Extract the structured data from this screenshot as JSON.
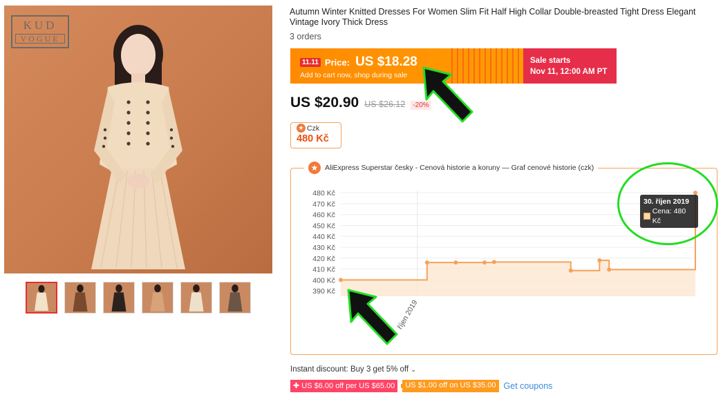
{
  "gallery": {
    "logo_line1": "KUD",
    "logo_line2": "VOGUE",
    "thumbnail_colors": [
      "#f2e2c8",
      "#7a4a2e",
      "#2b2220",
      "#d9a37a",
      "#efe1c9",
      "#6b5545"
    ]
  },
  "product": {
    "title": "Autumn Winter Knitted Dresses For Women Slim Fit Half High Collar Double-breasted Tight Dress Elegant Vintage Ivory Thick Dress",
    "orders": "3 orders"
  },
  "promo": {
    "badge": "11.11",
    "price_label": "Price:",
    "price": "US $18.28",
    "subtitle": "Add to cart now, shop during sale",
    "sale_starts": "Sale starts",
    "sale_date": "Nov 11, 12:00 AM PT",
    "colors": {
      "orange": "#ff8a00",
      "red": "#e62e4a"
    }
  },
  "pricing": {
    "current": "US $20.90",
    "original": "US $26.12",
    "discount": "-20%"
  },
  "czk_badge": {
    "label": "Czk",
    "value": "480 Kč"
  },
  "chart_legend": "AliExpress Superstar česky - Cenová historie a koruny — Graf cenové historie (czk)",
  "chart_data": {
    "type": "area",
    "title": "",
    "xlabel": "",
    "ylabel": "",
    "y_tick_labels": [
      "480 Kč",
      "470 Kč",
      "460 Kč",
      "450 Kč",
      "440 Kč",
      "430 Kč",
      "420 Kč",
      "410 Kč",
      "400 Kč",
      "390 Kč"
    ],
    "y_ticks": [
      480,
      470,
      460,
      450,
      440,
      430,
      420,
      410,
      400,
      390
    ],
    "ylim": [
      385,
      482
    ],
    "x_tick_labels": [
      "říjen 2019"
    ],
    "x_tick_days": [
      1
    ],
    "x_range_days": [
      -7,
      30
    ],
    "step": true,
    "color": "#f5a25a",
    "fill_color": "#fde4cc",
    "series": [
      {
        "points": [
          {
            "day": -7,
            "value": 400
          },
          {
            "day": 2,
            "value": 416
          },
          {
            "day": 5,
            "value": 416
          },
          {
            "day": 8,
            "value": 416
          },
          {
            "day": 9,
            "value": 416.5
          },
          {
            "day": 17,
            "value": 408.5
          },
          {
            "day": 20,
            "value": 418
          },
          {
            "day": 21,
            "value": 409.5
          },
          {
            "day": 30,
            "value": 480
          }
        ],
        "markers_days": [
          -7,
          2,
          5,
          8,
          9,
          17,
          20,
          21,
          30
        ]
      }
    ],
    "tooltip": {
      "title": "30. říjen 2019",
      "row": "Cena: 480 Kč"
    }
  },
  "offers": {
    "instant_discount": "Instant discount: Buy 3 get 5% off",
    "coupon1": "US $6.00 off per US $65.00",
    "coupon2": "US $1.00 off on US $35.00",
    "get_coupons": "Get coupons"
  },
  "annotation_color": "#22dd22"
}
